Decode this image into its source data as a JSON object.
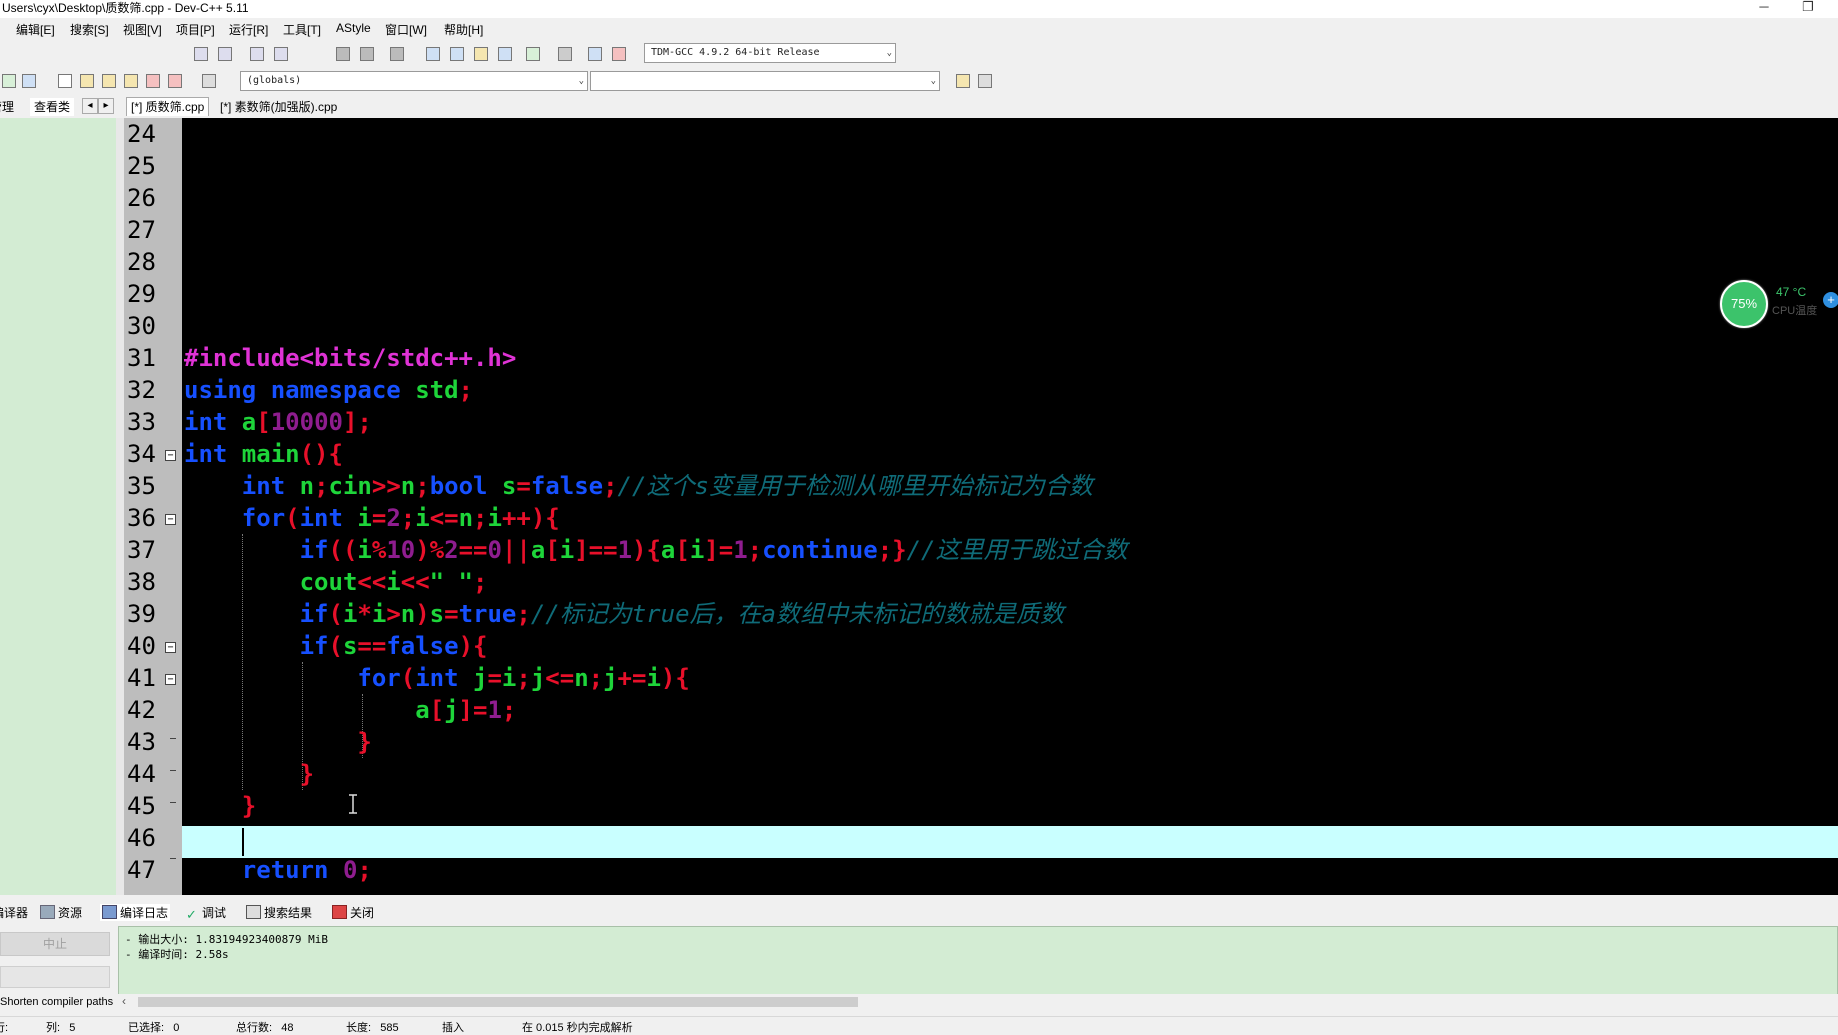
{
  "window": {
    "title": "Users\\cyx\\Desktop\\质数筛.cpp - Dev-C++ 5.11",
    "minimize": "─",
    "restore": "❐"
  },
  "menu": [
    "编辑[E]",
    "搜索[S]",
    "视图[V]",
    "项目[P]",
    "运行[R]",
    "工具[T]",
    "AStyle",
    "窗口[W]",
    "帮助[H]"
  ],
  "toolbar": {
    "compiler": "TDM-GCC 4.9.2 64-bit Release",
    "scope": "(globals)",
    "symbol": "",
    "dropdown_arrow": "⌄"
  },
  "left_tabs": [
    "管理",
    "查看类"
  ],
  "nav_arrows": [
    "◂",
    "▸"
  ],
  "file_tabs": [
    "[*] 质数筛.cpp",
    "[*] 素数筛(加强版).cpp"
  ],
  "editor": {
    "line_numbers": [
      "24",
      "25",
      "26",
      "27",
      "28",
      "29",
      "30",
      "31",
      "32",
      "33",
      "34",
      "35",
      "36",
      "37",
      "38",
      "39",
      "40",
      "41",
      "42",
      "43",
      "44",
      "45",
      "46",
      "47"
    ],
    "fold_markers": [
      "34",
      "36",
      "40",
      "41"
    ],
    "highlighted_line": "46",
    "code": {
      "l31": [
        "#include<bits/stdc++.h>"
      ],
      "l32": [
        "using namespace",
        " std",
        ";"
      ],
      "l33": [
        "int",
        " a",
        "[",
        "10000",
        "];"
      ],
      "l34": [
        "int",
        " main",
        "(){"
      ],
      "l35": [
        "    ",
        "int",
        " n",
        ";",
        "cin",
        ">>",
        "n",
        ";",
        "bool",
        " s",
        "=",
        "false",
        ";",
        "//这个s变量用于检测从哪里开始标记为合数"
      ],
      "l36": [
        "    ",
        "for",
        "(",
        "int",
        " i",
        "=",
        "2",
        ";",
        "i",
        "<=",
        "n",
        ";",
        "i",
        "++){"
      ],
      "l37": [
        "        ",
        "if",
        "((",
        "i",
        "%",
        "10",
        ")%",
        "2",
        "==",
        "0",
        "||",
        "a",
        "[",
        "i",
        "]==",
        "1",
        "){",
        "a",
        "[",
        "i",
        "]=",
        "1",
        ";",
        "continue",
        ";}",
        "//这里用于跳过合数"
      ],
      "l38": [
        "        ",
        "cout",
        "<<",
        "i",
        "<<",
        "\" \"",
        ";"
      ],
      "l39": [
        "        ",
        "if",
        "(",
        "i",
        "*",
        "i",
        ">",
        "n",
        ")",
        "s",
        "=",
        "true",
        ";",
        "//标记为true后，在a数组中未标记的数就是质数"
      ],
      "l40": [
        "        ",
        "if",
        "(",
        "s",
        "==",
        "false",
        "){"
      ],
      "l41": [
        "            ",
        "for",
        "(",
        "int",
        " j",
        "=",
        "i",
        ";",
        "j",
        "<=",
        "n",
        ";",
        "j",
        "+=",
        "i",
        "){"
      ],
      "l42": [
        "                ",
        "a",
        "[",
        "j",
        "]=",
        "1",
        ";"
      ],
      "l43": [
        "            ",
        "}"
      ],
      "l44": [
        "        ",
        "}"
      ],
      "l45": [
        "    ",
        "}"
      ],
      "l47": [
        "    ",
        "return",
        " ",
        "0",
        ";"
      ]
    }
  },
  "cpu_widget": {
    "percent": "75%",
    "temperature": "47 °C",
    "label": "CPU温度",
    "plus": "+"
  },
  "bottom_tabs": [
    "编译器",
    "资源",
    "编译日志",
    "调试",
    "搜索结果",
    "关闭"
  ],
  "bottom_left": {
    "abort": "中止",
    "shorten": "Shorten compiler paths"
  },
  "log": [
    "- 输出大小: 1.83194923400879 MiB",
    "- 编译时间: 2.58s"
  ],
  "scroll_left": "‹",
  "status": {
    "row_label": "行:",
    "row_value": "",
    "col_label": "列:",
    "col_value": "5",
    "sel_label": "已选择:",
    "sel_value": "0",
    "lines_label": "总行数:",
    "lines_value": "48",
    "len_label": "长度:",
    "len_value": "585",
    "mode": "插入",
    "parse": "在 0.015 秒内完成解析"
  },
  "colors": {
    "editor_bg": "#000000",
    "keyword": "#1650ff",
    "identifier": "#1ed53a",
    "number": "#8f1d8f",
    "symbol": "#e8102a",
    "preprocessor": "#e033d6",
    "comment": "#0f6b78",
    "current_line": "#c9ffff",
    "panel_green": "#d3ecd3"
  }
}
